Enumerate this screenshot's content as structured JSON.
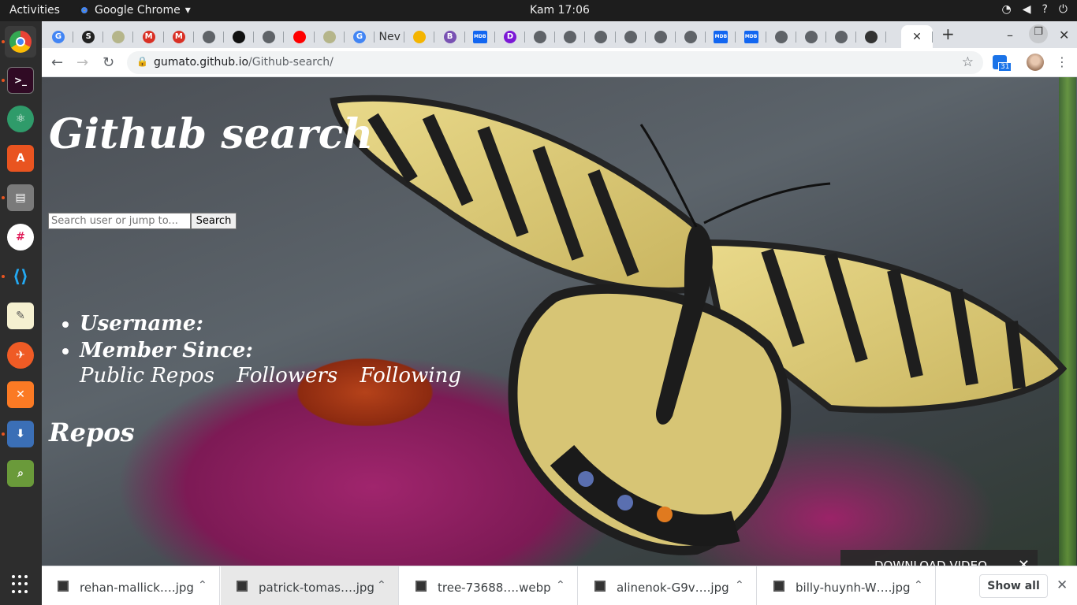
{
  "topbar": {
    "activities": "Activities",
    "app_name": "Google Chrome",
    "clock": "Kam 17:06"
  },
  "tabs": [
    {
      "icon": "google-icon",
      "label": "G",
      "color": "#4285f4"
    },
    {
      "icon": "s-icon",
      "label": "S",
      "color": "#222222"
    },
    {
      "icon": "tree-icon",
      "label": "",
      "color": "#b5b58a"
    },
    {
      "icon": "gmail-icon",
      "label": "M",
      "color": "#d93025"
    },
    {
      "icon": "gmail-icon",
      "label": "M",
      "color": "#d93025"
    },
    {
      "icon": "globe-icon",
      "label": "",
      "color": "#5f6368"
    },
    {
      "icon": "unsplash-icon",
      "label": "",
      "color": "#111111"
    },
    {
      "icon": "globe-icon",
      "label": "",
      "color": "#5f6368"
    },
    {
      "icon": "youtube-icon",
      "label": "",
      "color": "#ff0000"
    },
    {
      "icon": "tree-icon",
      "label": "",
      "color": "#b5b58a"
    },
    {
      "icon": "google-icon",
      "label": "G",
      "color": "#4285f4"
    },
    {
      "icon": "text-tab",
      "label": "Nev",
      "color": "#dee1e6"
    },
    {
      "icon": "emoji-icon",
      "label": "",
      "color": "#f4b400"
    },
    {
      "icon": "bootstrap-icon",
      "label": "B",
      "color": "#7952b3"
    },
    {
      "icon": "mdb-icon",
      "label": "MDB",
      "color": "#1266f1"
    },
    {
      "icon": "d-icon",
      "label": "D",
      "color": "#7c18d6"
    },
    {
      "icon": "globe-icon",
      "label": "",
      "color": "#5f6368"
    },
    {
      "icon": "globe-icon",
      "label": "",
      "color": "#5f6368"
    },
    {
      "icon": "globe-icon",
      "label": "",
      "color": "#5f6368"
    },
    {
      "icon": "globe-icon",
      "label": "",
      "color": "#5f6368"
    },
    {
      "icon": "globe-icon",
      "label": "",
      "color": "#5f6368"
    },
    {
      "icon": "globe-icon",
      "label": "",
      "color": "#5f6368"
    },
    {
      "icon": "mdb-icon",
      "label": "MDB",
      "color": "#1266f1"
    },
    {
      "icon": "mdb-icon",
      "label": "MDB",
      "color": "#1266f1"
    },
    {
      "icon": "globe-icon",
      "label": "",
      "color": "#5f6368"
    },
    {
      "icon": "globe-icon",
      "label": "",
      "color": "#5f6368"
    },
    {
      "icon": "globe-icon",
      "label": "",
      "color": "#5f6368"
    },
    {
      "icon": "terminal-icon",
      "label": "",
      "color": "#333333"
    }
  ],
  "address": {
    "host": "gumato.github.io",
    "path": "/Github-search/"
  },
  "page": {
    "title": "Github search",
    "search_placeholder": "Search user or jump to...",
    "search_button": "Search",
    "username_label": "Username:",
    "member_since_label": "Member Since:",
    "public_repos_label": "Public Repos",
    "followers_label": "Followers",
    "following_label": "Following",
    "repos_heading": "Repos"
  },
  "overlay": {
    "download_video": "DOWNLOAD VIDEO"
  },
  "downloads": [
    {
      "name": "rehan-mallick….jpg"
    },
    {
      "name": "patrick-tomas….jpg"
    },
    {
      "name": "tree-73688….webp"
    },
    {
      "name": "alinenok-G9v….jpg"
    },
    {
      "name": "billy-huynh-W….jpg"
    }
  ],
  "shelf": {
    "show_all": "Show all"
  },
  "calendar_badge": "31"
}
